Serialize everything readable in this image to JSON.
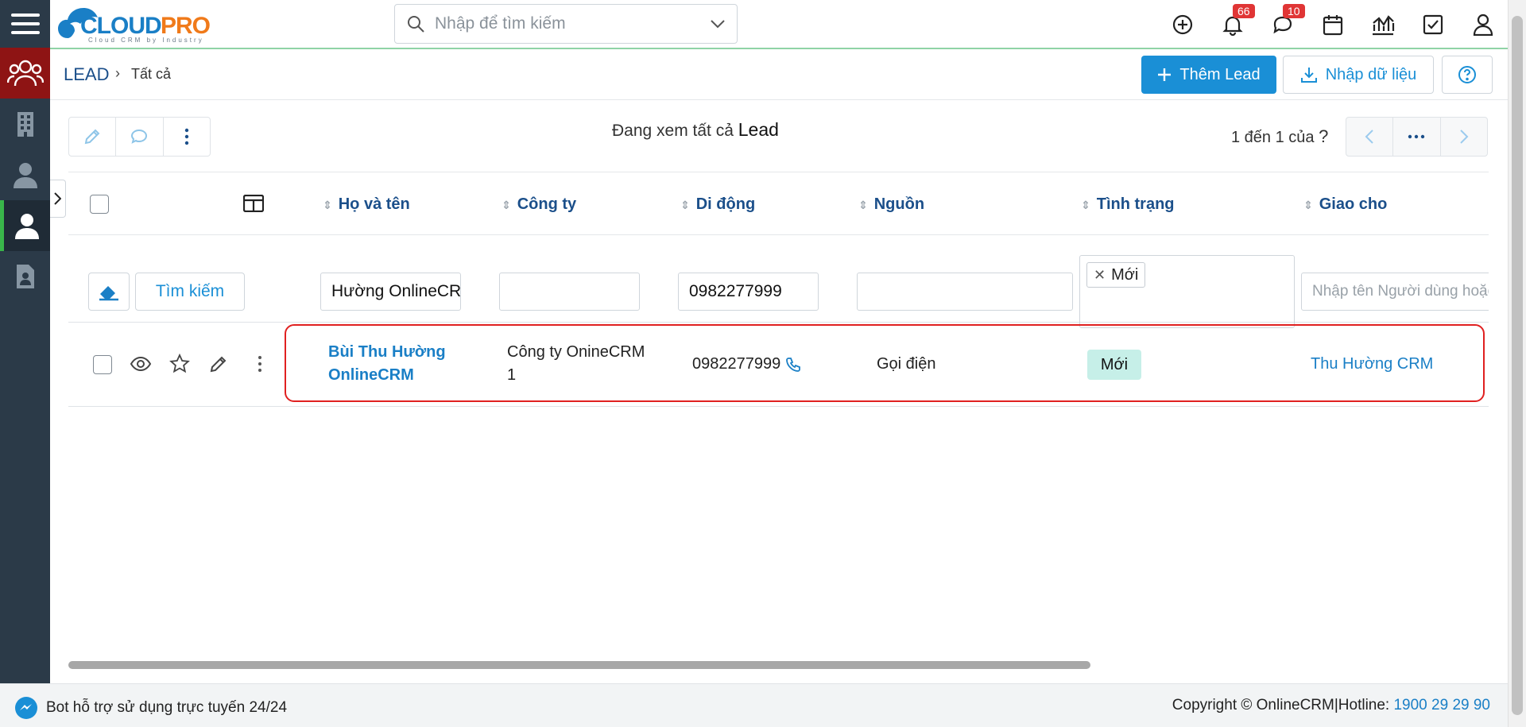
{
  "app": {
    "logo_text": "CLOUDPRO",
    "logo_tagline": "Cloud CRM by Industry"
  },
  "search": {
    "placeholder": "Nhập để tìm kiếm"
  },
  "notifications": {
    "bell_count": "66",
    "chat_count": "10"
  },
  "breadcrumb": {
    "module": "LEAD",
    "view": "Tất cả"
  },
  "actions": {
    "add_label": "Thêm Lead",
    "import_label": "Nhập dữ liệu"
  },
  "list_header": {
    "viewing_prefix": "Đang xem tất cả",
    "viewing_entity": "Lead"
  },
  "pagination": {
    "range_text": "1 đến 1 của",
    "unknown_total": "?"
  },
  "columns": [
    "Họ và tên",
    "Công ty",
    "Di động",
    "Nguồn",
    "Tình trạng",
    "Giao cho"
  ],
  "filters": {
    "search_label": "Tìm kiếm",
    "name": "Hường OnlineCRM",
    "company": "",
    "mobile": "0982277999",
    "source": "",
    "status_chip": "Mới",
    "assignee_placeholder": "Nhập tên Người dùng hoặc Nhóm"
  },
  "rows": [
    {
      "name_line1": "Bùi Thu Hường",
      "name_line2": "OnlineCRM",
      "company_line1": "Công ty OnineCRM",
      "company_line2": "1",
      "mobile": "0982277999",
      "source": "Gọi điện",
      "status": "Mới",
      "assignee": "Thu Hường CRM"
    }
  ],
  "footer": {
    "bot_text": "Bot hỗ trợ sử dụng trực tuyến 24/24",
    "copyright": "Copyright © OnlineCRM|Hotline: ",
    "hotline": "1900 29 29 90"
  },
  "colors": {
    "primary": "#1a8fd6",
    "sidebar": "#2b3a48",
    "accent_red": "#8e1414",
    "status_new_bg": "#c6efe8",
    "highlight": "#e02020"
  }
}
